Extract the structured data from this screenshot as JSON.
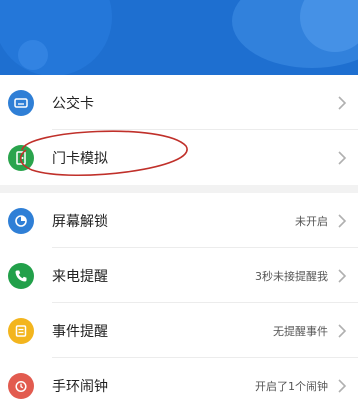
{
  "items": [
    {
      "label": "公交卡",
      "status": "",
      "icon": "bus-card-icon",
      "color": "#2f7fd6"
    },
    {
      "label": "门卡模拟",
      "status": "",
      "icon": "door-card-icon",
      "color": "#2aa44d"
    },
    {
      "label": "屏幕解锁",
      "status": "未开启",
      "icon": "unlock-icon",
      "color": "#2f7fd6"
    },
    {
      "label": "来电提醒",
      "status": "3秒未接提醒我",
      "icon": "phone-icon",
      "color": "#22a04a"
    },
    {
      "label": "事件提醒",
      "status": "无提醒事件",
      "icon": "event-icon",
      "color": "#f3b51e"
    },
    {
      "label": "手环闹钟",
      "status": "开启了1个闹钟",
      "icon": "alarm-clock-icon",
      "color": "#e25b4f"
    }
  ],
  "colors": {
    "header": "#1e6fd0",
    "annotation": "#c0302a"
  }
}
